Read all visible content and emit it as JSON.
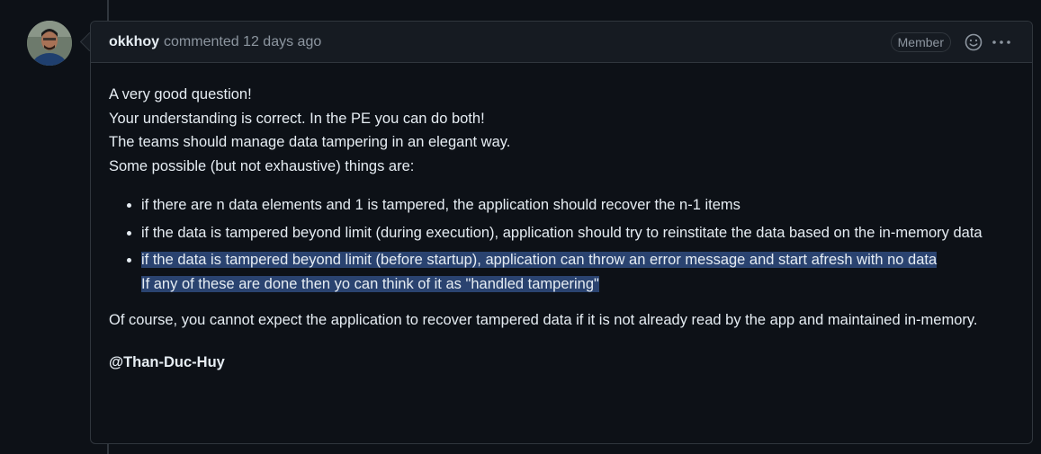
{
  "comment": {
    "author": "okkhoy",
    "meta": "commented 12 days ago",
    "role_badge": "Member",
    "header_icons": [
      "smiley-icon",
      "kebab-menu-icon"
    ],
    "body": {
      "intro_lines": [
        "A very good question!",
        "Your understanding is correct. In the PE you can do both!",
        "The teams should manage data tampering in an elegant way.",
        "Some possible (but not exhaustive) things are:"
      ],
      "bullets": [
        "if there are n data elements and 1 is tampered, the application should recover the n-1 items",
        "if the data is tampered beyond limit (during execution), application should try to reinstitate the data based on the in-memory data",
        "if the data is tampered beyond limit (before startup), application can throw an error message and start afresh with no data"
      ],
      "bullet3_continuation": "If any of these are done then yo can think of it as \"handled tampering\"",
      "closing": "Of course, you cannot expect the application to recover tampered data if it is not already read by the app and maintained in-memory.",
      "mention": "@Than-Duc-Huy"
    }
  },
  "colors": {
    "background": "#0d1117",
    "header_background": "#161b22",
    "border": "#30363d",
    "text": "#e6edf3",
    "muted_text": "#8d96a0",
    "selection_highlight": "#2a4370"
  }
}
